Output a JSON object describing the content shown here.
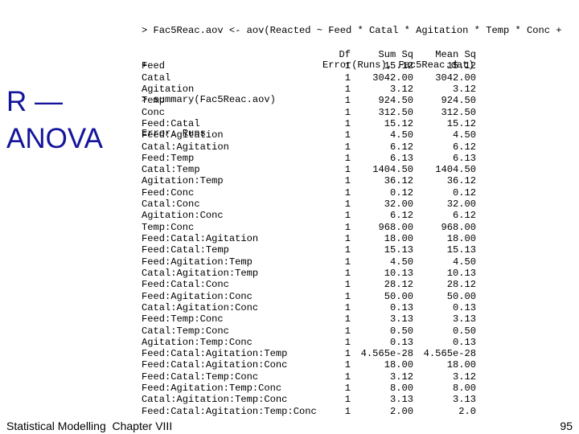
{
  "slide": {
    "title_lines": "R —\nANOVA",
    "title_color": "#14149c",
    "background_color": "#ffffff",
    "text_color": "#000000"
  },
  "console": {
    "lines": [
      "> Fac5Reac.aov <- aov(Reacted ~ Feed * Catal * Agitation * Temp * Conc +",
      "+                              Error(Runs), Fac5Reac.dat)",
      "> summary(Fac5Reac.aov)",
      "Error: Runs",
      ""
    ]
  },
  "table": {
    "headers": [
      "",
      "Df",
      "Sum Sq",
      "Mean Sq"
    ],
    "rows": [
      {
        "term": "Feed",
        "df": "1",
        "sum_sq": "15.12",
        "mean_sq": "15.12"
      },
      {
        "term": "Catal",
        "df": "1",
        "sum_sq": "3042.00",
        "mean_sq": "3042.00"
      },
      {
        "term": "Agitation",
        "df": "1",
        "sum_sq": "3.12",
        "mean_sq": "3.12"
      },
      {
        "term": "Temp",
        "df": "1",
        "sum_sq": "924.50",
        "mean_sq": "924.50"
      },
      {
        "term": "Conc",
        "df": "1",
        "sum_sq": "312.50",
        "mean_sq": "312.50"
      },
      {
        "term": "Feed:Catal",
        "df": "1",
        "sum_sq": "15.12",
        "mean_sq": "15.12"
      },
      {
        "term": "Feed:Agitation",
        "df": "1",
        "sum_sq": "4.50",
        "mean_sq": "4.50"
      },
      {
        "term": "Catal:Agitation",
        "df": "1",
        "sum_sq": "6.12",
        "mean_sq": "6.12"
      },
      {
        "term": "Feed:Temp",
        "df": "1",
        "sum_sq": "6.13",
        "mean_sq": "6.13"
      },
      {
        "term": "Catal:Temp",
        "df": "1",
        "sum_sq": "1404.50",
        "mean_sq": "1404.50"
      },
      {
        "term": "Agitation:Temp",
        "df": "1",
        "sum_sq": "36.12",
        "mean_sq": "36.12"
      },
      {
        "term": "Feed:Conc",
        "df": "1",
        "sum_sq": "0.12",
        "mean_sq": "0.12"
      },
      {
        "term": "Catal:Conc",
        "df": "1",
        "sum_sq": "32.00",
        "mean_sq": "32.00"
      },
      {
        "term": "Agitation:Conc",
        "df": "1",
        "sum_sq": "6.12",
        "mean_sq": "6.12"
      },
      {
        "term": "Temp:Conc",
        "df": "1",
        "sum_sq": "968.00",
        "mean_sq": "968.00"
      },
      {
        "term": "Feed:Catal:Agitation",
        "df": "1",
        "sum_sq": "18.00",
        "mean_sq": "18.00"
      },
      {
        "term": "Feed:Catal:Temp",
        "df": "1",
        "sum_sq": "15.13",
        "mean_sq": "15.13"
      },
      {
        "term": "Feed:Agitation:Temp",
        "df": "1",
        "sum_sq": "4.50",
        "mean_sq": "4.50"
      },
      {
        "term": "Catal:Agitation:Temp",
        "df": "1",
        "sum_sq": "10.13",
        "mean_sq": "10.13"
      },
      {
        "term": "Feed:Catal:Conc",
        "df": "1",
        "sum_sq": "28.12",
        "mean_sq": "28.12"
      },
      {
        "term": "Feed:Agitation:Conc",
        "df": "1",
        "sum_sq": "50.00",
        "mean_sq": "50.00"
      },
      {
        "term": "Catal:Agitation:Conc",
        "df": "1",
        "sum_sq": "0.13",
        "mean_sq": "0.13"
      },
      {
        "term": "Feed:Temp:Conc",
        "df": "1",
        "sum_sq": "3.13",
        "mean_sq": "3.13"
      },
      {
        "term": "Catal:Temp:Conc",
        "df": "1",
        "sum_sq": "0.50",
        "mean_sq": "0.50"
      },
      {
        "term": "Agitation:Temp:Conc",
        "df": "1",
        "sum_sq": "0.13",
        "mean_sq": "0.13"
      },
      {
        "term": "Feed:Catal:Agitation:Temp",
        "df": "1",
        "sum_sq": "4.565e-28",
        "mean_sq": "4.565e-28"
      },
      {
        "term": "Feed:Catal:Agitation:Conc",
        "df": "1",
        "sum_sq": "18.00",
        "mean_sq": "18.00"
      },
      {
        "term": "Feed:Catal:Temp:Conc",
        "df": "1",
        "sum_sq": "3.12",
        "mean_sq": "3.12"
      },
      {
        "term": "Feed:Agitation:Temp:Conc",
        "df": "1",
        "sum_sq": "8.00",
        "mean_sq": "8.00"
      },
      {
        "term": "Catal:Agitation:Temp:Conc",
        "df": "1",
        "sum_sq": "3.13",
        "mean_sq": "3.13"
      },
      {
        "term": "Feed:Catal:Agitation:Temp:Conc",
        "df": "1",
        "sum_sq": "2.00",
        "mean_sq": "2.0"
      }
    ]
  },
  "footer": {
    "left_text": "Statistical Modelling  Chapter VIII",
    "page_number": "95"
  }
}
